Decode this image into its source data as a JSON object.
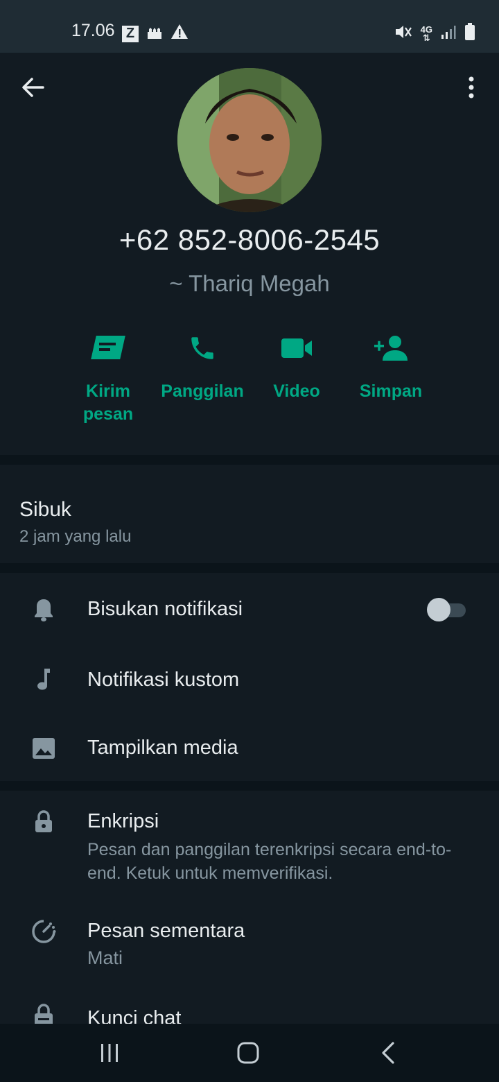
{
  "status_bar": {
    "time": "17.06",
    "left_icons": [
      "z-app-icon",
      "mosque-icon",
      "warning-icon"
    ],
    "right_icons": [
      "mute-icon",
      "4g-icon",
      "signal-icon",
      "battery-icon"
    ],
    "network": "4G"
  },
  "header": {
    "phone": "+62 852-8006-2545",
    "alias": "~ Thariq Megah"
  },
  "actions": [
    {
      "label": "Kirim pesan",
      "icon": "message-icon"
    },
    {
      "label": "Panggilan",
      "icon": "phone-icon"
    },
    {
      "label": "Video",
      "icon": "video-icon"
    },
    {
      "label": "Simpan",
      "icon": "add-person-icon"
    }
  ],
  "about": {
    "status": "Sibuk",
    "time": "2 jam yang lalu"
  },
  "settings": {
    "mute": "Bisukan notifikasi",
    "mute_on": false,
    "custom": "Notifikasi kustom",
    "media": "Tampilkan media"
  },
  "security": {
    "encryption_title": "Enkripsi",
    "encryption_desc": "Pesan dan panggilan terenkripsi secara end-to-end. Ketuk untuk memverifikasi.",
    "disappearing_title": "Pesan sementara",
    "disappearing_value": "Mati",
    "lock_title": "Kunci chat"
  },
  "colors": {
    "accent": "#00a884",
    "background": "#121b22",
    "divider": "#0b141a"
  }
}
